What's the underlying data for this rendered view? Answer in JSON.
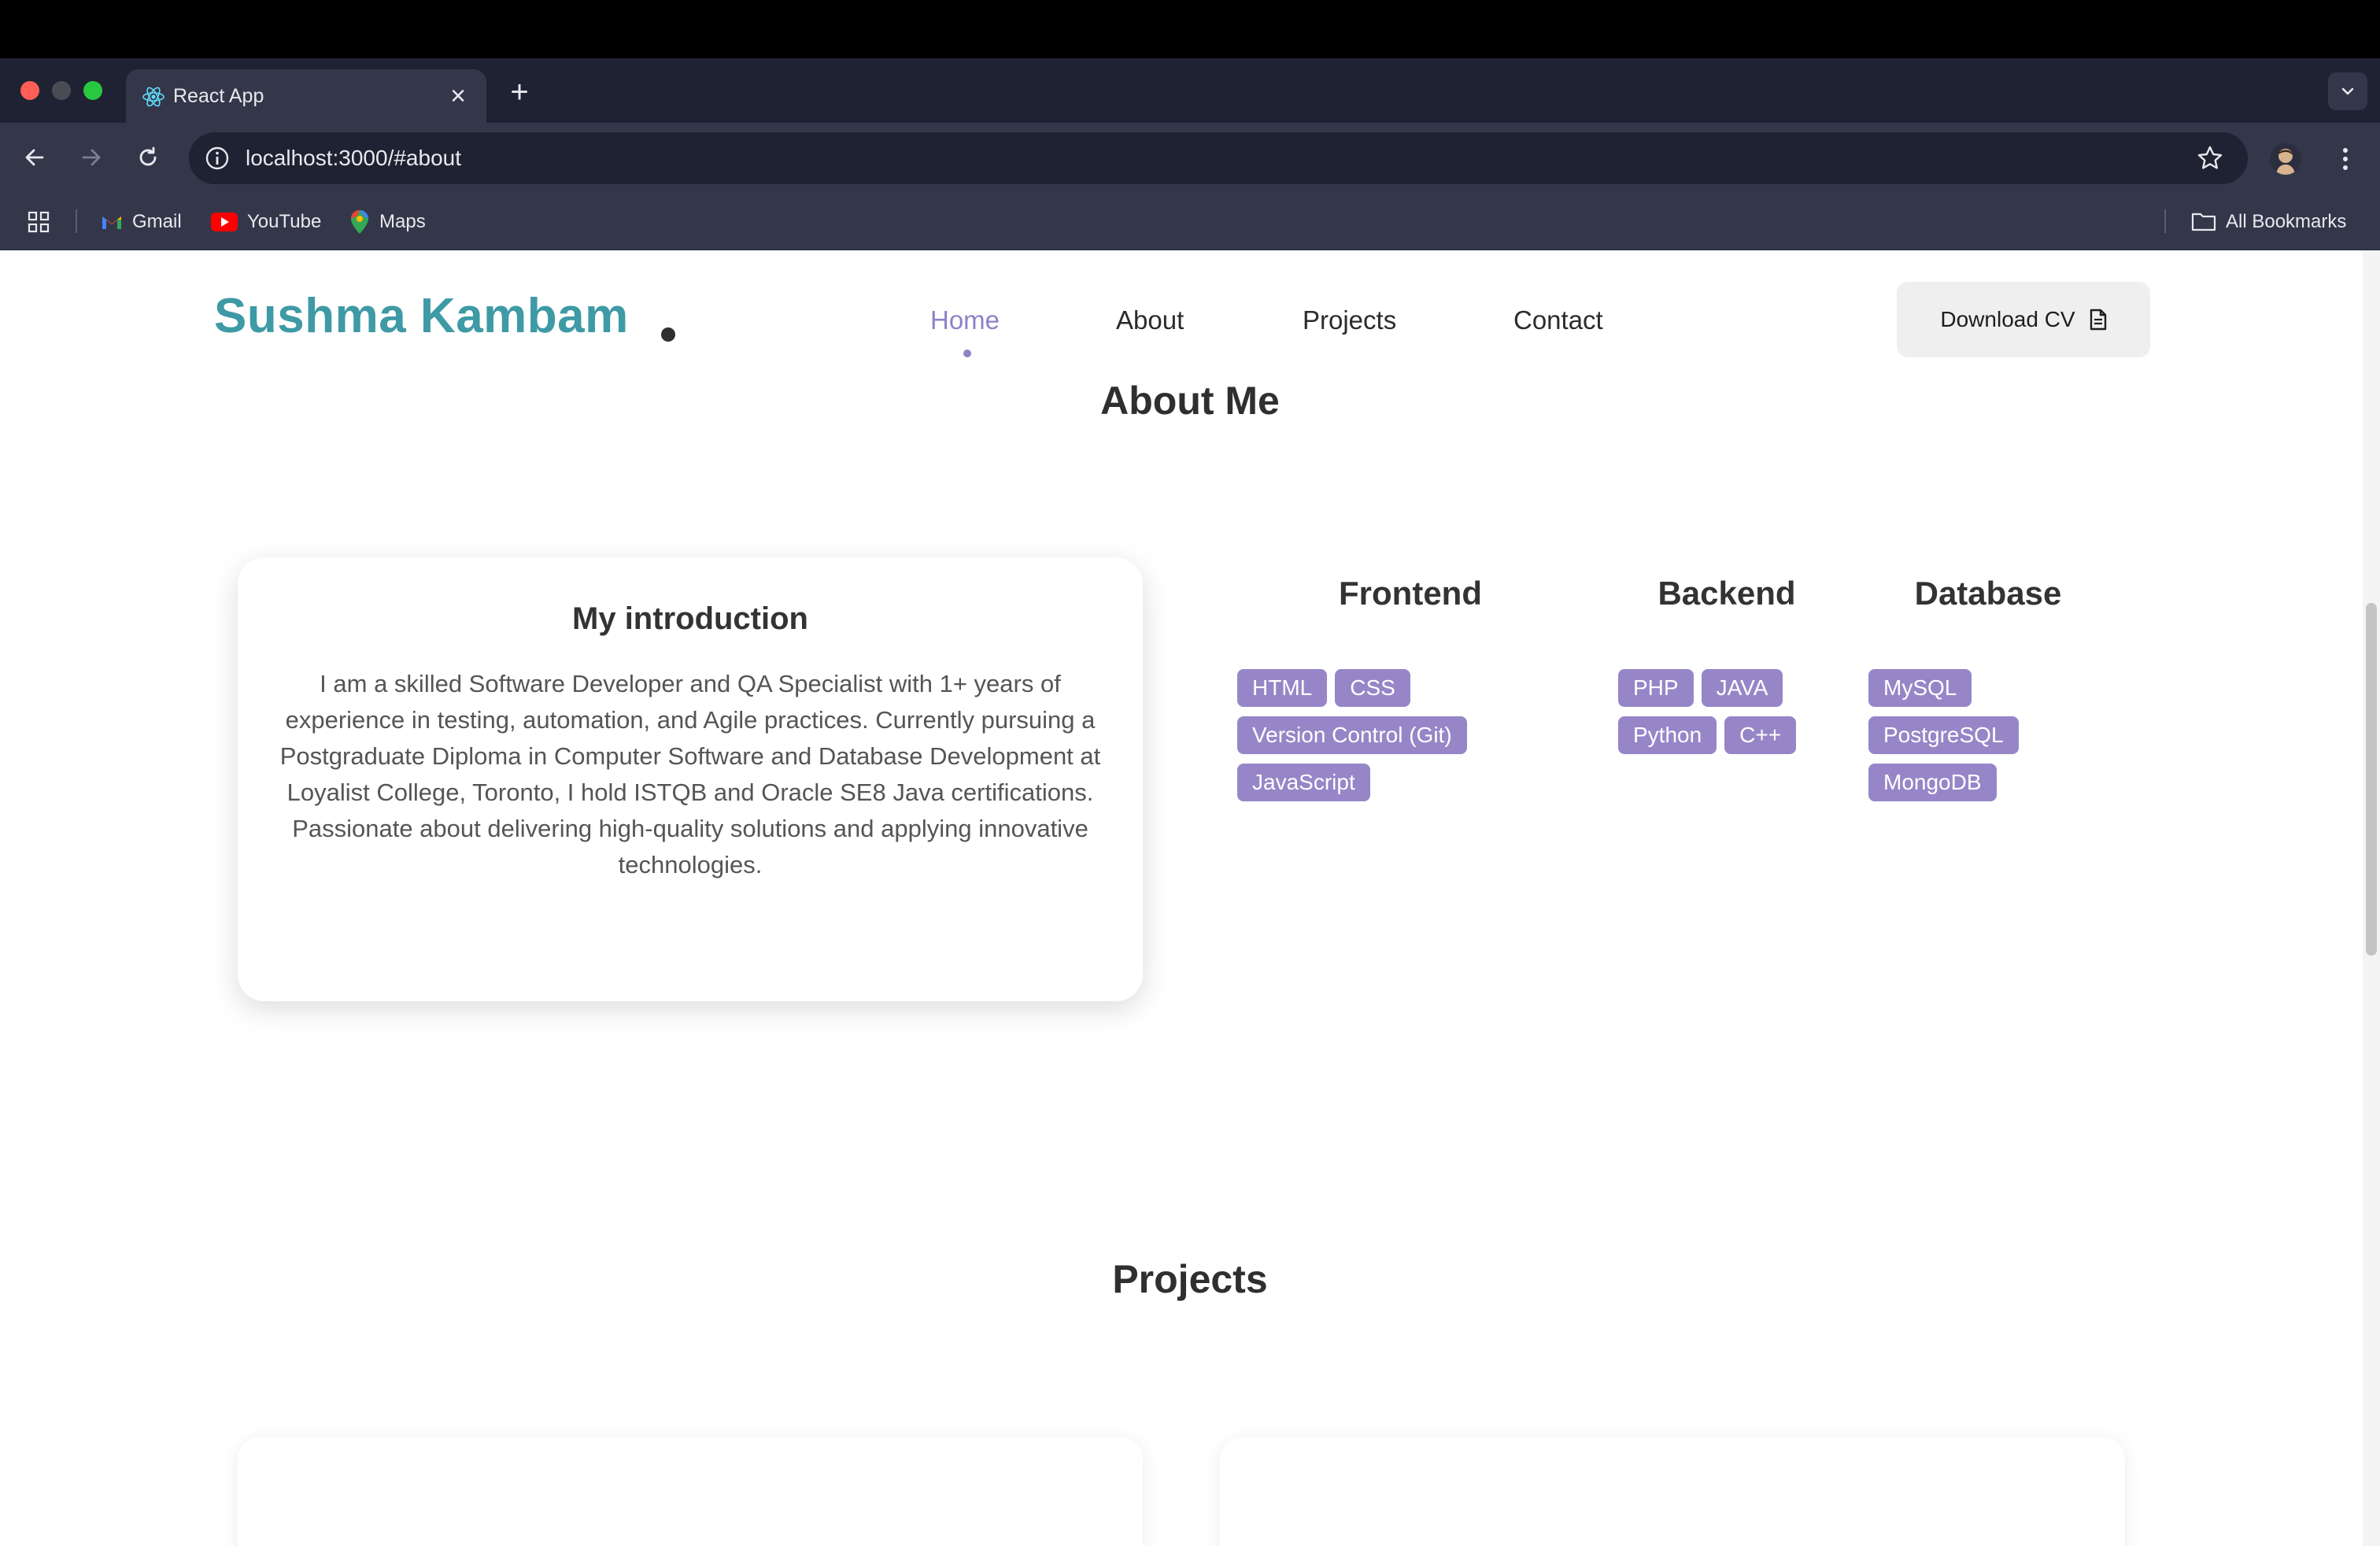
{
  "browser": {
    "tab_title": "React App",
    "url": "localhost:3000/#about",
    "bookmarks": [
      {
        "label": "Gmail",
        "icon": "gmail-icon"
      },
      {
        "label": "YouTube",
        "icon": "youtube-icon"
      },
      {
        "label": "Maps",
        "icon": "maps-icon"
      }
    ],
    "all_bookmarks_label": "All Bookmarks"
  },
  "site": {
    "logo": "Sushma Kambam",
    "nav": [
      "Home",
      "About",
      "Projects",
      "Contact"
    ],
    "active_nav": "Home",
    "download_cv_label": "Download CV",
    "accent_color": "#8f82c7",
    "logo_color": "#3e9aa5",
    "tag_color": "#9686c7"
  },
  "about": {
    "title": "About Me",
    "intro_title": "My introduction",
    "intro_text": "I am a skilled Software Developer and QA Specialist with 1+ years of experience in testing, automation, and Agile practices. Currently pursuing a Postgraduate Diploma in Computer Software and Database Development at Loyalist College, Toronto, I hold ISTQB and Oracle SE8 Java certifications. Passionate about delivering high-quality solutions and applying innovative technologies.",
    "skills": {
      "frontend": {
        "title": "Frontend",
        "items": [
          "HTML",
          "CSS",
          "Version Control (Git)",
          "JavaScript"
        ]
      },
      "backend": {
        "title": "Backend",
        "items": [
          "PHP",
          "JAVA",
          "Python",
          "C++"
        ]
      },
      "database": {
        "title": "Database",
        "items": [
          "MySQL",
          "PostgreSQL",
          "MongoDB"
        ]
      }
    }
  },
  "projects": {
    "title": "Projects"
  }
}
